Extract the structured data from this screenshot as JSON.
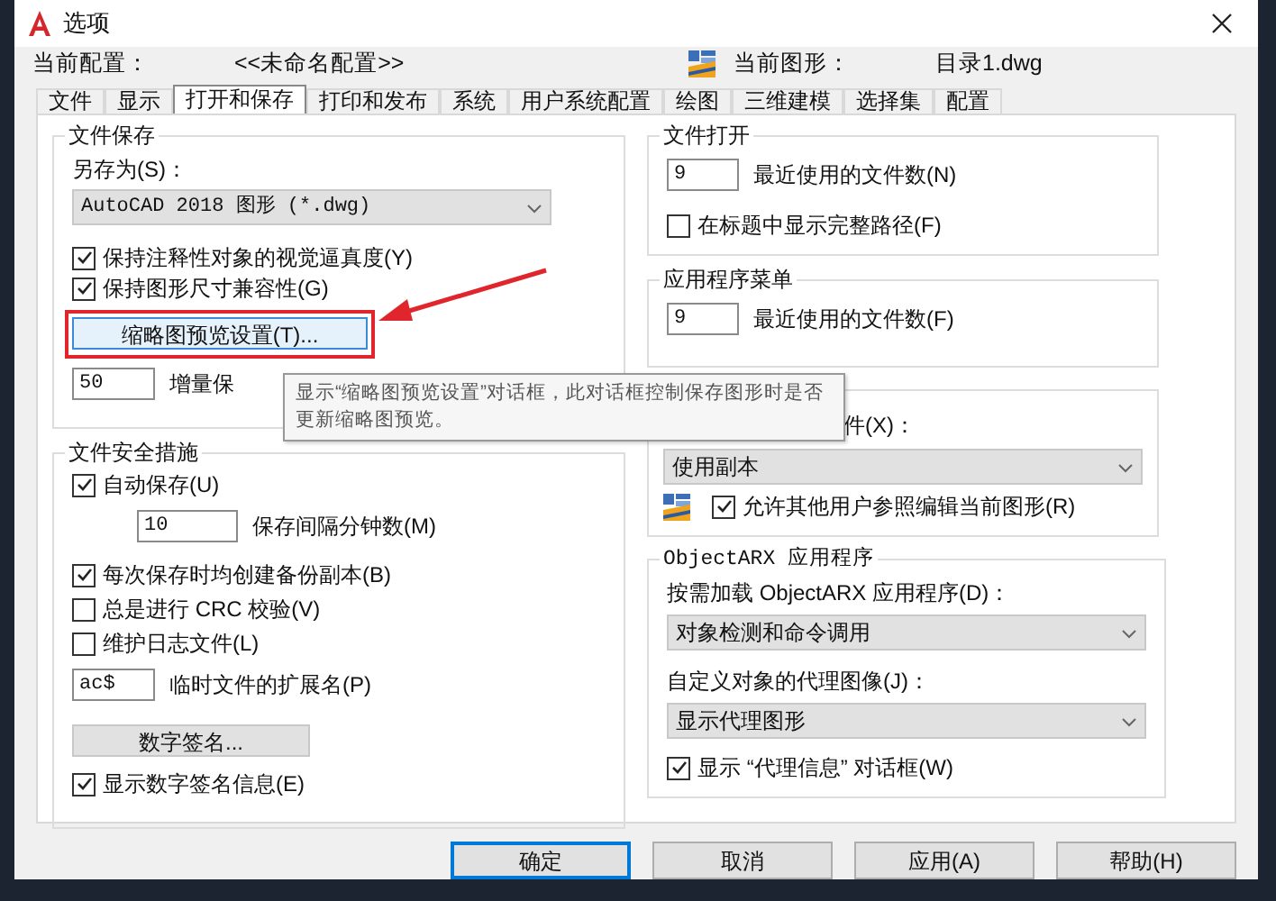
{
  "window": {
    "title": "选项"
  },
  "profile": {
    "label": "当前配置：",
    "value": "<<未命名配置>>"
  },
  "drawing": {
    "label": "当前图形：",
    "value": "目录1.dwg"
  },
  "tabs": [
    {
      "label": "文件",
      "selected": false
    },
    {
      "label": "显示",
      "selected": false
    },
    {
      "label": "打开和保存",
      "selected": true
    },
    {
      "label": "打印和发布",
      "selected": false
    },
    {
      "label": "系统",
      "selected": false
    },
    {
      "label": "用户系统配置",
      "selected": false
    },
    {
      "label": "绘图",
      "selected": false
    },
    {
      "label": "三维建模",
      "selected": false
    },
    {
      "label": "选择集",
      "selected": false
    },
    {
      "label": "配置",
      "selected": false
    }
  ],
  "file_save": {
    "title": "文件保存",
    "save_as_label": "另存为(S)：",
    "save_as_value": "AutoCAD 2018 图形 (*.dwg)",
    "checkboxes": [
      {
        "label": "保持注释性对象的视觉逼真度(Y)",
        "checked": true
      },
      {
        "label": "保持图形尺寸兼容性(G)",
        "checked": true
      }
    ],
    "thumbnail_button": "缩略图预览设置(T)...",
    "incremental_value": "50",
    "incremental_label": "增量保"
  },
  "file_safety": {
    "title": "文件安全措施",
    "items": [
      {
        "kind": "checkbox",
        "label": "自动保存(U)",
        "checked": true
      },
      {
        "kind": "field",
        "input": "10",
        "caption": "保存间隔分钟数(M)",
        "indented": true
      },
      {
        "kind": "checkbox",
        "label": "每次保存时均创建备份副本(B)",
        "checked": true
      },
      {
        "kind": "checkbox",
        "label": "总是进行 CRC 校验(V)",
        "checked": false
      },
      {
        "kind": "checkbox",
        "label": "维护日志文件(L)",
        "checked": false
      },
      {
        "kind": "field",
        "input": "ac$",
        "caption": "临时文件的扩展名(P)",
        "indented": false
      },
      {
        "kind": "button",
        "label": "数字签名..."
      },
      {
        "kind": "checkbox",
        "label": "显示数字签名信息(E)",
        "checked": true
      }
    ]
  },
  "file_open": {
    "title": "文件打开",
    "items": [
      {
        "kind": "field",
        "input": "9",
        "caption": "最近使用的文件数(N)",
        "indented": false
      },
      {
        "kind": "checkbox",
        "label": "在标题中显示完整路径(F)",
        "checked": false
      }
    ]
  },
  "app_menu": {
    "title": "应用程序菜单",
    "items": [
      {
        "kind": "field",
        "input": "9",
        "caption": "最近使用的文件数(F)",
        "indented": false
      }
    ]
  },
  "xref": {
    "label": "件(X)：",
    "dropdown": "使用副本",
    "checkbox": {
      "label": "允许其他用户参照编辑当前图形(R)",
      "checked": true
    }
  },
  "objectarx": {
    "title": "ObjectARX 应用程序",
    "items": [
      {
        "kind": "dropdown",
        "label": "按需加载 ObjectARX 应用程序(D)：",
        "value": "对象检测和命令调用"
      },
      {
        "kind": "dropdown",
        "label": "自定义对象的代理图像(J)：",
        "value": "显示代理图形"
      },
      {
        "kind": "checkbox",
        "label": "显示 “代理信息” 对话框(W)",
        "checked": true
      }
    ]
  },
  "tooltip": {
    "text": "显示“缩略图预览设置”对话框，此对话框控制保存图形时是否更新缩略图预览。"
  },
  "buttons": [
    {
      "label": "确定",
      "default": true
    },
    {
      "label": "取消",
      "default": false
    },
    {
      "label": "应用(A)",
      "default": false
    },
    {
      "label": "帮助(H)",
      "default": false
    }
  ]
}
